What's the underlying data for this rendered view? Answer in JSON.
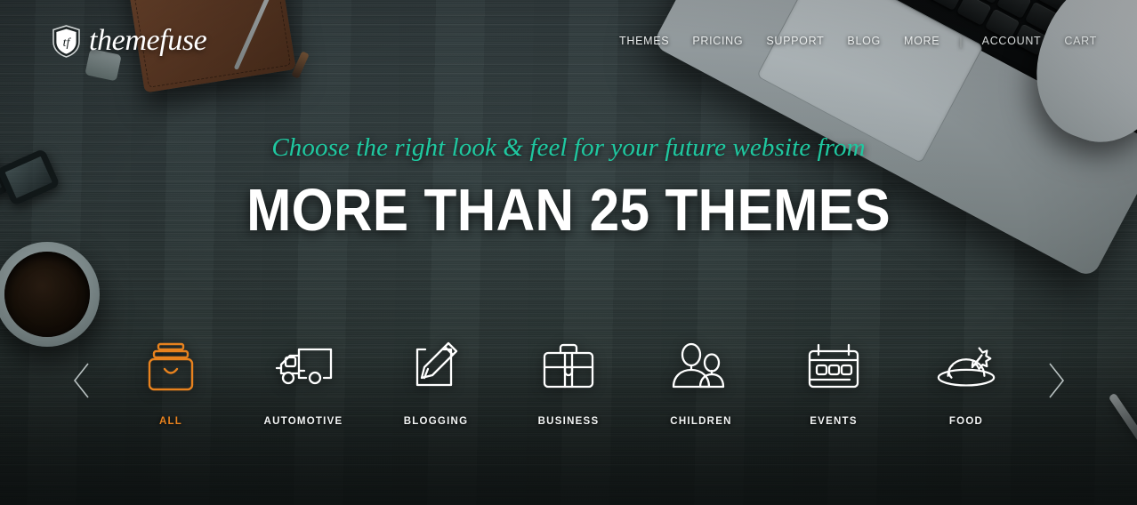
{
  "brand": {
    "shield_initials": "tf",
    "wordmark": "themefuse",
    "accent_orange": "#e8821e",
    "accent_teal": "#1fc8a0",
    "background": "#2b3537"
  },
  "nav": {
    "items": [
      {
        "label": "THEMES"
      },
      {
        "label": "PRICING"
      },
      {
        "label": "SUPPORT"
      },
      {
        "label": "BLOG"
      },
      {
        "label": "MORE"
      }
    ],
    "divider": "|",
    "account": "ACCOUNT",
    "cart": "CART"
  },
  "hero": {
    "subtitle": "Choose the right look & feel for your future website from",
    "title": "MORE THAN 25 THEMES"
  },
  "carousel": {
    "prev_arrow": "chevron-left-icon",
    "next_arrow": "chevron-right-icon",
    "categories": [
      {
        "label": "ALL",
        "icon": "stacked-boxes-icon",
        "active": true
      },
      {
        "label": "AUTOMOTIVE",
        "icon": "truck-icon",
        "active": false
      },
      {
        "label": "BLOGGING",
        "icon": "pencil-notepad-icon",
        "active": false
      },
      {
        "label": "BUSINESS",
        "icon": "briefcase-icon",
        "active": false
      },
      {
        "label": "CHILDREN",
        "icon": "two-people-icon",
        "active": false
      },
      {
        "label": "EVENTS",
        "icon": "calendar-icon",
        "active": false
      },
      {
        "label": "FOOD",
        "icon": "roast-platter-icon",
        "active": false
      }
    ]
  }
}
